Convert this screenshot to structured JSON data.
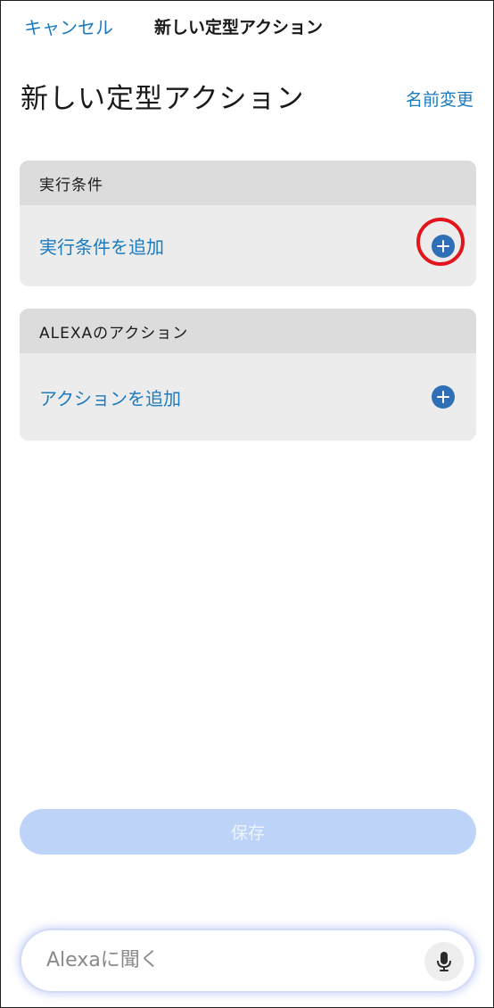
{
  "nav": {
    "cancel_label": "キャンセル",
    "title": "新しい定型アクション"
  },
  "header": {
    "title": "新しい定型アクション",
    "rename_label": "名前変更"
  },
  "sections": [
    {
      "header": "実行条件",
      "action_label": "実行条件を追加",
      "icon": "plus-circle-icon",
      "highlighted": true
    },
    {
      "header": "ALEXAのアクション",
      "action_label": "アクションを追加",
      "icon": "plus-circle-icon",
      "highlighted": false
    }
  ],
  "save": {
    "label": "保存",
    "disabled": true
  },
  "ask_bar": {
    "placeholder": "Alexaに聞く",
    "icon": "microphone-icon"
  },
  "colors": {
    "accent": "#1c7bbf",
    "plus_icon": "#2f6fb6",
    "highlight": "#e3141b",
    "save_disabled": "#bdd3f7"
  }
}
